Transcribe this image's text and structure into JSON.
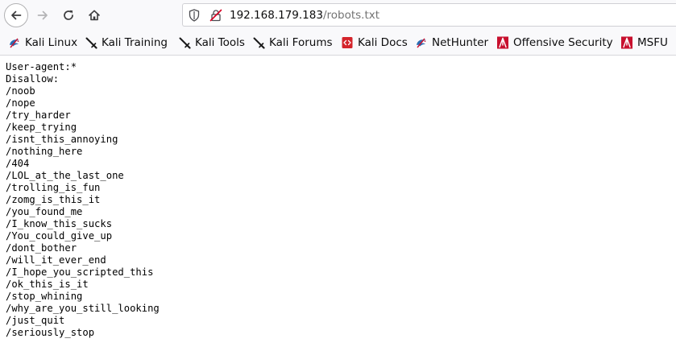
{
  "browser": {
    "url": {
      "host": "192.168.179.183",
      "path": "/robots.txt"
    },
    "icons": {
      "back": "arrow-left-icon",
      "forward": "arrow-right-icon",
      "reload": "reload-icon",
      "home": "home-icon",
      "tracking": "shield-icon",
      "security": "insecure-lock-icon"
    }
  },
  "bookmarks": [
    {
      "label": "Kali Linux",
      "icon": "kali-dragon-icon"
    },
    {
      "label": "Kali Training",
      "icon": "kali-sword-icon"
    },
    {
      "label": "Kali Tools",
      "icon": "kali-sword-icon"
    },
    {
      "label": "Kali Forums",
      "icon": "kali-sword-icon"
    },
    {
      "label": "Kali Docs",
      "icon": "docs-icon"
    },
    {
      "label": "NetHunter",
      "icon": "kali-dragon-icon"
    },
    {
      "label": "Offensive Security",
      "icon": "offsec-icon"
    },
    {
      "label": "MSFU",
      "icon": "offsec-icon"
    }
  ],
  "colors": {
    "offsec_red": "#c8102e",
    "kali_blue": "#2a6db3",
    "docs_red": "#d4242b"
  },
  "document": {
    "lines": [
      "User-agent:*",
      "Disallow:",
      "/noob",
      "/nope",
      "/try_harder",
      "/keep_trying",
      "/isnt_this_annoying",
      "/nothing_here",
      "/404",
      "/LOL_at_the_last_one",
      "/trolling_is_fun",
      "/zomg_is_this_it",
      "/you_found_me",
      "/I_know_this_sucks",
      "/You_could_give_up",
      "/dont_bother",
      "/will_it_ever_end",
      "/I_hope_you_scripted_this",
      "/ok_this_is_it",
      "/stop_whining",
      "/why_are_you_still_looking",
      "/just_quit",
      "/seriously_stop"
    ]
  }
}
